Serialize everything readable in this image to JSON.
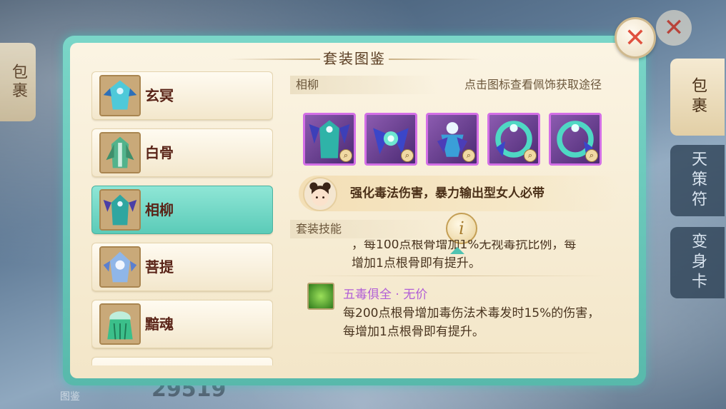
{
  "background": {
    "bag_left_label": "包裹",
    "side_tabs": [
      "包裹",
      "天策符",
      "变身卡"
    ],
    "bottom_number": "29519",
    "bottom_label": "图鉴"
  },
  "dialog": {
    "title": "套装图鉴",
    "close_symbol": "✕"
  },
  "list": {
    "items": [
      {
        "label": "玄冥",
        "selected": false
      },
      {
        "label": "白骨",
        "selected": false
      },
      {
        "label": "相柳",
        "selected": true
      },
      {
        "label": "菩提",
        "selected": false
      },
      {
        "label": "黯魂",
        "selected": false
      }
    ]
  },
  "panel": {
    "set_name": "相柳",
    "hint": "点击图标查看佩饰获取途径",
    "slots": [
      "robe-icon",
      "wing-ornament-icon",
      "flower-pendant-icon",
      "jade-bracelet-icon",
      "jade-bracelet-icon"
    ],
    "description": "强化毒法伤害，暴力输出型女人必带",
    "section_title": "套装技能",
    "info_symbol": "i"
  },
  "skills": {
    "prev_line1": "，每100点根骨增加1%无视毒抗比例，每",
    "prev_line2": "增加1点根骨即有提升。",
    "name": "五毒俱全 · 无价",
    "desc": "每200点根骨增加毒伤法术毒发时15%的伤害，每增加1点根骨即有提升。"
  },
  "colors": {
    "accent": "#5bcbb8",
    "selected_item": "#5bcbb8",
    "slot_border": "#d36fe6",
    "skill_name": "#b25fd6",
    "close_x": "#e0513f"
  }
}
